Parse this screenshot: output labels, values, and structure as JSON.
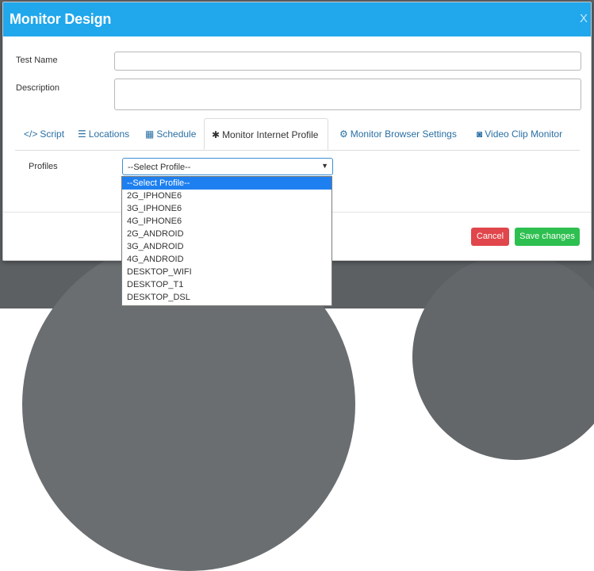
{
  "modal": {
    "title": "Monitor Design",
    "close_label": "X"
  },
  "form": {
    "test_name_label": "Test Name",
    "test_name_value": "",
    "description_label": "Description",
    "description_value": ""
  },
  "tabs": [
    {
      "label": "Script",
      "icon": "code-icon",
      "glyph": "</>"
    },
    {
      "label": "Locations",
      "icon": "sliders-icon",
      "glyph": "☰"
    },
    {
      "label": "Schedule",
      "icon": "calendar-icon",
      "glyph": "▦"
    },
    {
      "label": "Monitor Internet Profile",
      "icon": "gear-icon",
      "glyph": "✱",
      "active": true
    },
    {
      "label": "Monitor Browser Settings",
      "icon": "gears-icon",
      "glyph": "⚙"
    },
    {
      "label": "Video Clip Monitor",
      "icon": "camera-icon",
      "glyph": "◙"
    }
  ],
  "profiles": {
    "label": "Profiles",
    "selected": "--Select Profile--",
    "options": [
      "--Select Profile--",
      "2G_IPHONE6",
      "3G_IPHONE6",
      "4G_IPHONE6",
      "2G_ANDROID",
      "3G_ANDROID",
      "4G_ANDROID",
      "DESKTOP_WIFI",
      "DESKTOP_T1",
      "DESKTOP_DSL"
    ]
  },
  "footer": {
    "cancel_label": "Cancel",
    "save_label": "Save changes"
  },
  "colors": {
    "header": "#20a7ec",
    "cancel": "#e0464b",
    "save": "#2dbf4f",
    "selection": "#1e80f0"
  }
}
